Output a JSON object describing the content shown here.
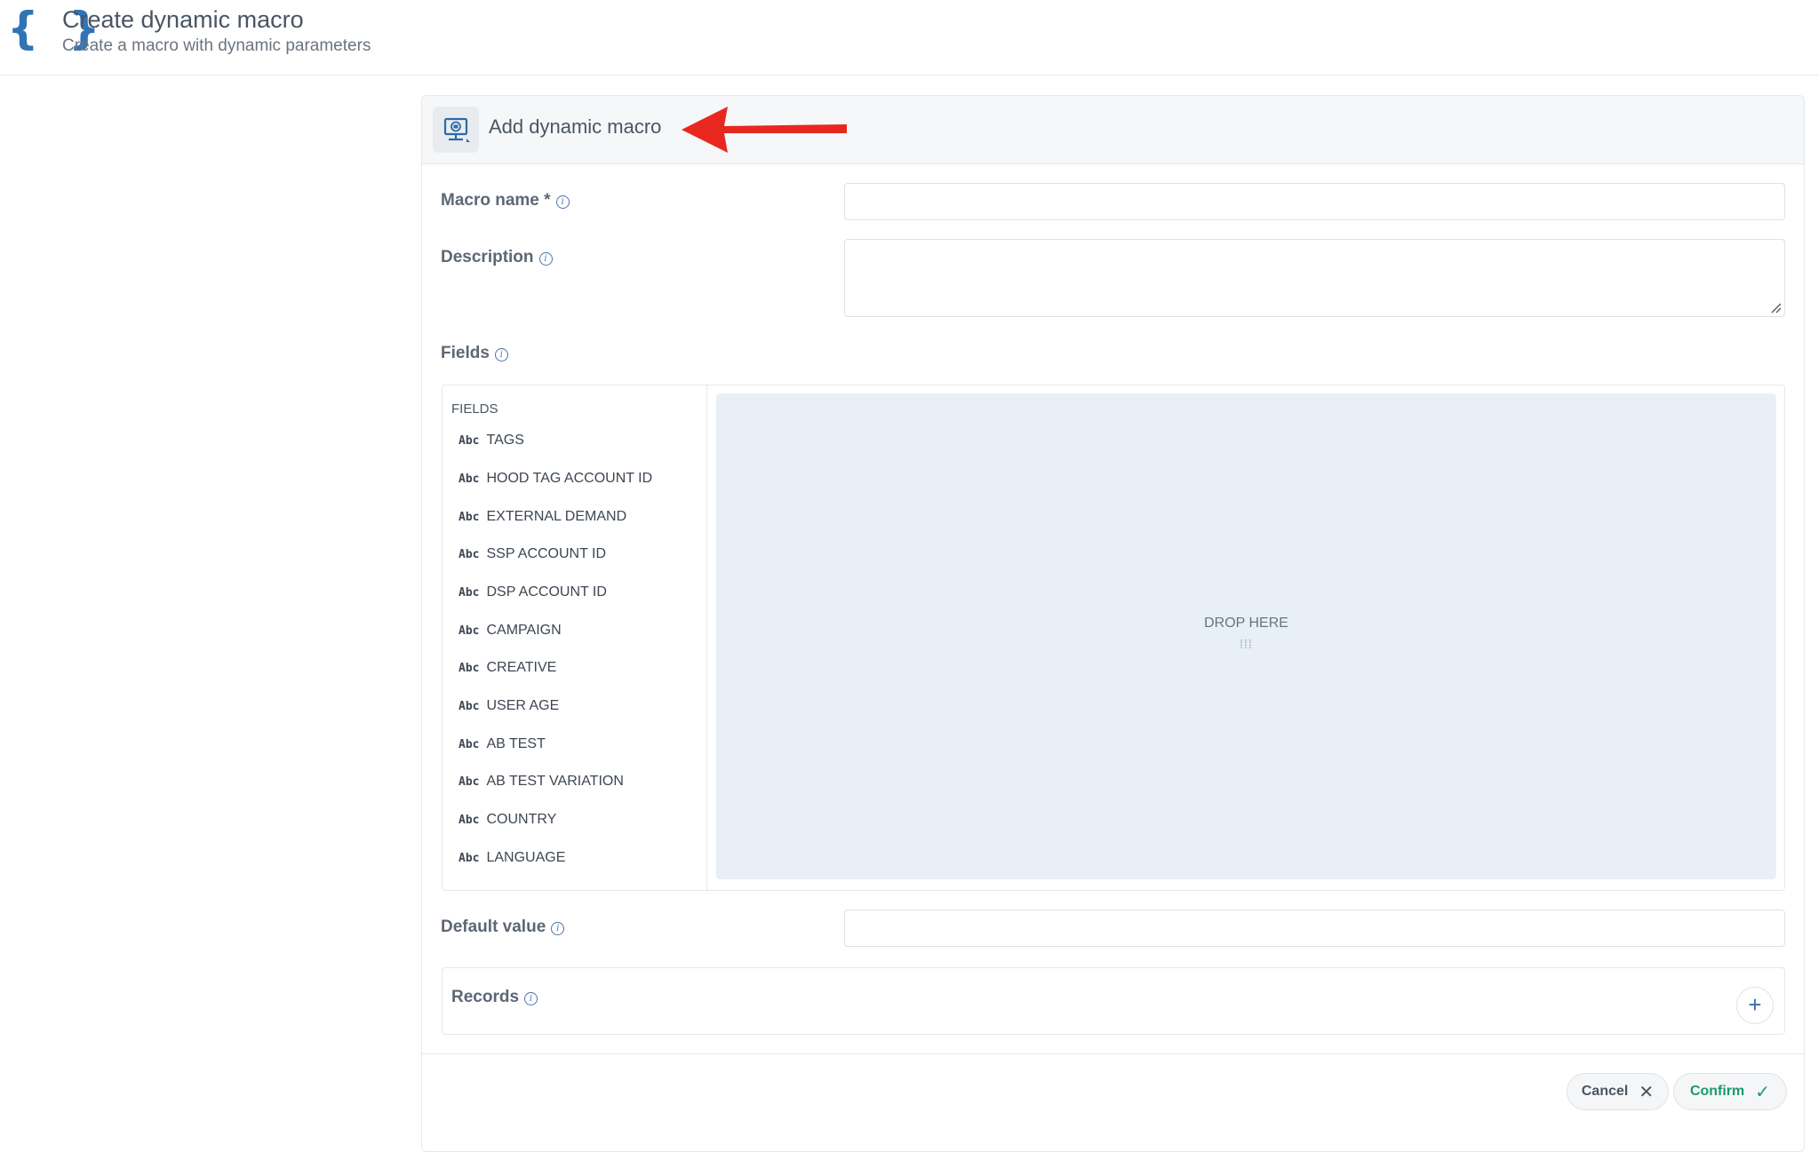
{
  "header": {
    "brace_icon": "{ }",
    "title": "Create dynamic macro",
    "subtitle": "Create a macro with dynamic parameters"
  },
  "card": {
    "title": "Add dynamic macro",
    "icon": "macro-monitor-icon",
    "annotation": "red-arrow-pointing-left"
  },
  "form": {
    "macro_name_label": "Macro name *",
    "macro_name_value": "",
    "description_label": "Description",
    "description_value": "",
    "fields_label": "Fields",
    "default_value_label": "Default value",
    "default_value_value": "",
    "records_label": "Records",
    "info_glyph": "i"
  },
  "fields": {
    "heading": "FIELDS",
    "type_badge": "Abc",
    "items": [
      "TAGS",
      "HOOD TAG ACCOUNT ID",
      "EXTERNAL DEMAND",
      "SSP ACCOUNT ID",
      "DSP ACCOUNT ID",
      "CAMPAIGN",
      "CREATIVE",
      "USER AGE",
      "AB TEST",
      "AB TEST VARIATION",
      "COUNTRY",
      "LANGUAGE"
    ],
    "drop_zone_text": "DROP HERE",
    "drop_zone_dots": "⁞⁞⁞"
  },
  "records": {
    "add_glyph": "+"
  },
  "actions": {
    "cancel_label": "Cancel",
    "cancel_glyph": "✕",
    "confirm_label": "Confirm",
    "confirm_glyph": "✓"
  },
  "colors": {
    "brand_blue": "#2f75b5",
    "confirm_green": "#1a9a6c",
    "arrow_red": "#e8281f",
    "drop_zone_bg": "#e8eff6"
  }
}
